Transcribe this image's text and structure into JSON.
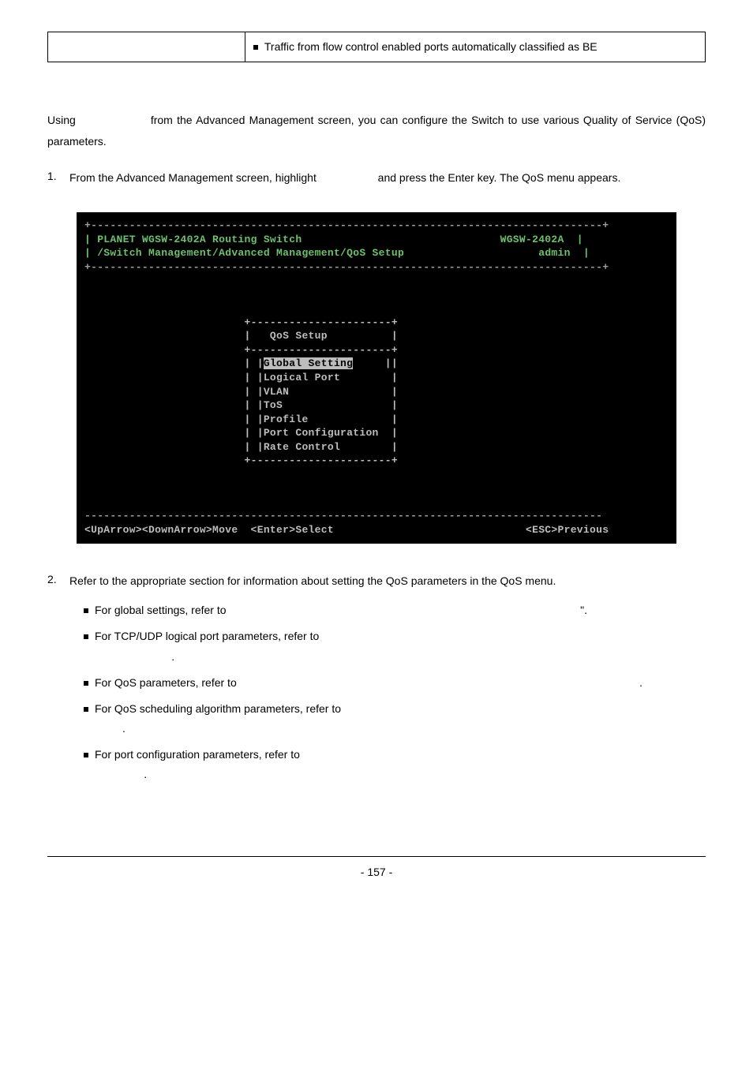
{
  "table": {
    "bullet": "Traffic from flow control enabled ports automatically classified as BE"
  },
  "intro": {
    "using_label": "Using",
    "body": "from the Advanced Management screen, you can configure the Switch to use various Quality of Service (QoS) parameters."
  },
  "step1": {
    "num": "1.",
    "line1": "From the Advanced Management screen, highlight",
    "line1_end": "and press the Enter key. The QoS",
    "line2": "menu appears."
  },
  "terminal": {
    "rawtop": "+--------------------------------------------------------------------------------+",
    "hdr1": "| PLANET WGSW-2402A Routing Switch",
    "hdr1r": "WGSW-2402A  |",
    "hdr2": "| /Switch Management/Advanced Management/QoS Setup",
    "hdr2r": "admin  |",
    "rawbot": "+--------------------------------------------------------------------------------+",
    "box_top": "                         +----------------------+",
    "box_title": "                         |   QoS Setup          |",
    "box_sep": "                         +----------------------+",
    "g1a": "                         | |",
    "g1b": "Global Setting",
    "g1c": "     ||",
    "l_logical": "                         | |Logical Port        |",
    "l_vlan": "                         | |VLAN                |",
    "l_tos": "                         | |ToS                 |",
    "l_profile": "                         | |Profile             |",
    "l_portcfg": "                         | |Port Configuration  |",
    "l_rate": "                         | |Rate Control        |",
    "box_end": "                         +----------------------+",
    "bottom_rule": "---------------------------------------------------------------------------------",
    "nav": "<UpArrow><DownArrow>Move  <Enter>Select                              <ESC>Previous"
  },
  "step2": {
    "num": "2.",
    "body": "Refer to the appropriate section for information about setting the QoS parameters in the QoS menu.",
    "b1a": "For global settings, refer to",
    "b1b": "\".",
    "b2a": "For TCP/UDP logical port parameters, refer to",
    "b2b": ".",
    "b3a": "For QoS parameters, refer to",
    "b3b": ".",
    "b4a": "For QoS scheduling algorithm parameters, refer to",
    "b4b": ".",
    "b5a": "For port configuration parameters, refer to",
    "b5b": "."
  },
  "footer": {
    "page": "- 157 -"
  }
}
